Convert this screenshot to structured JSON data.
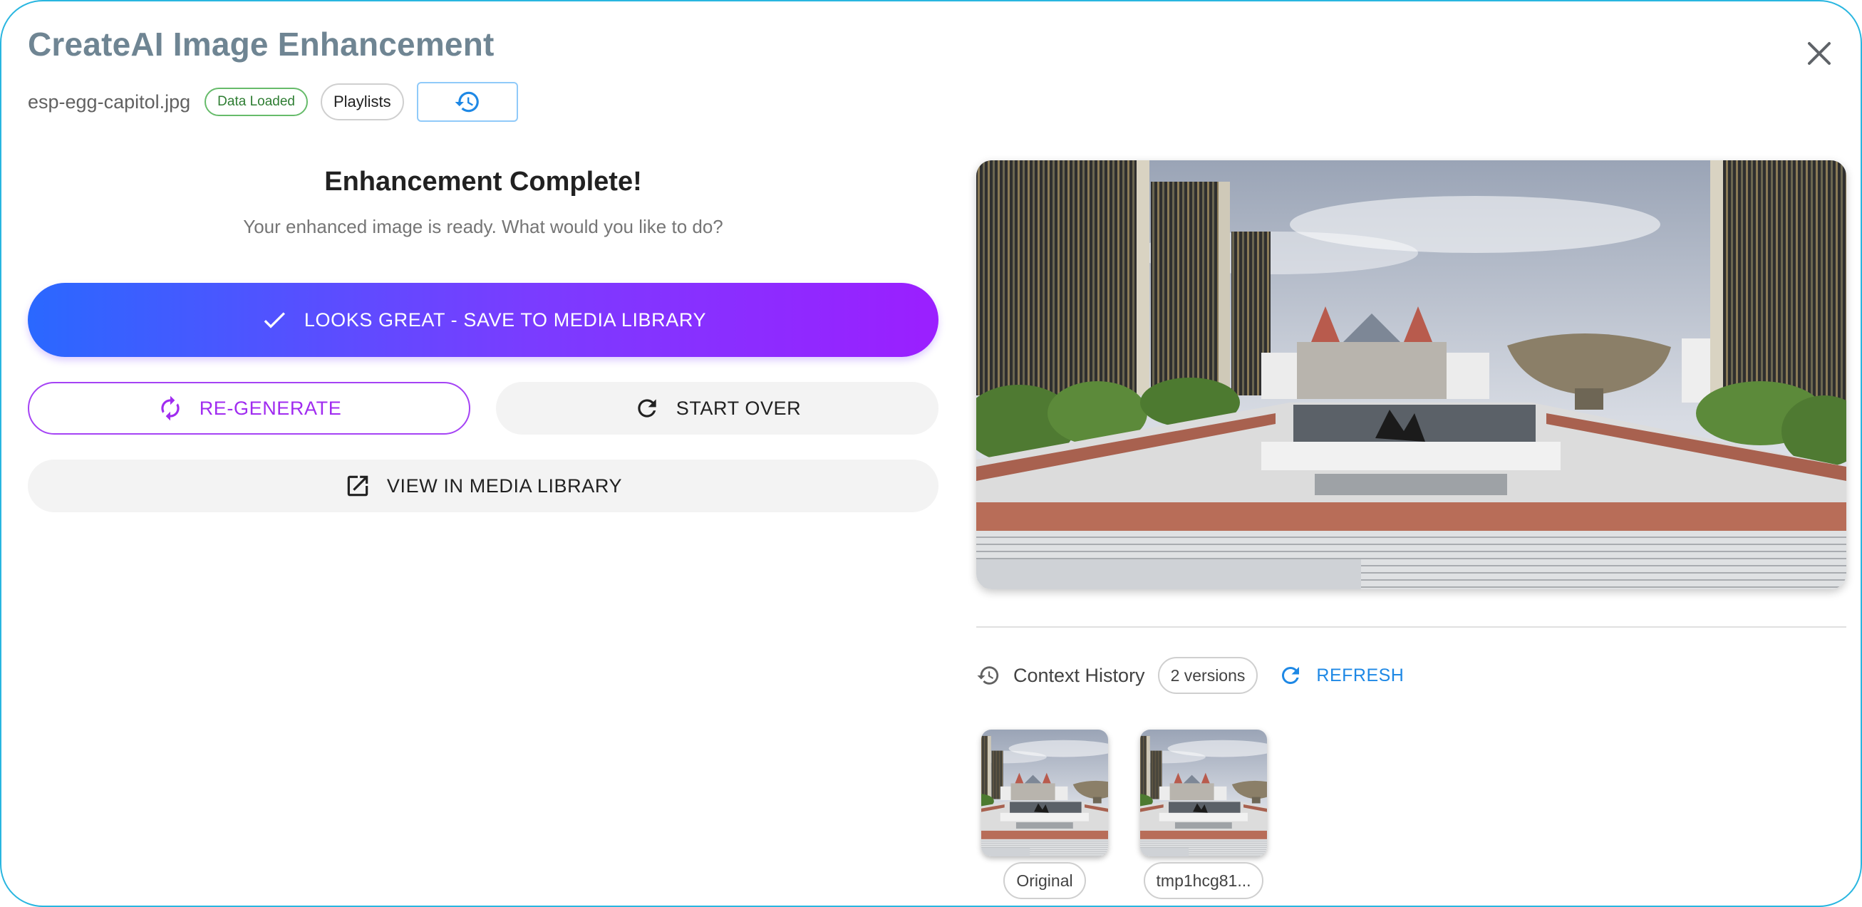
{
  "dialog": {
    "title": "CreateAI Image Enhancement",
    "close_icon": "close-icon"
  },
  "meta": {
    "filename": "esp-egg-capitol.jpg",
    "status_chip": "Data Loaded",
    "playlists_chip": "Playlists",
    "history_icon": "history-icon"
  },
  "result": {
    "heading": "Enhancement Complete!",
    "subheading": "Your enhanced image is ready. What would you like to do?"
  },
  "actions": {
    "save_label": "LOOKS GREAT - SAVE TO MEDIA LIBRARY",
    "regenerate_label": "RE-GENERATE",
    "start_over_label": "START OVER",
    "view_library_label": "VIEW IN MEDIA LIBRARY"
  },
  "context_history": {
    "label": "Context History",
    "count_chip": "2 versions",
    "refresh_label": "REFRESH",
    "versions": [
      {
        "label": "Original"
      },
      {
        "label": "tmp1hcg81..."
      }
    ]
  },
  "colors": {
    "accent_blue": "#2a68ff",
    "accent_purple": "#9b1fff",
    "success_green": "#2e7d32",
    "link_blue": "#1e88e5",
    "dialog_border": "#29b6e0"
  }
}
